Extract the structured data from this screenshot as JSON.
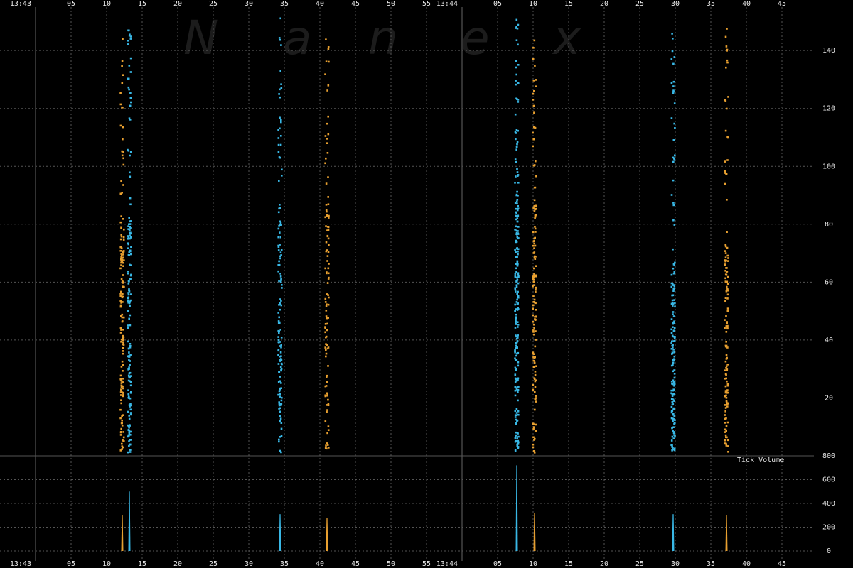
{
  "watermark": [
    "N",
    "a",
    "n",
    "e",
    "x"
  ],
  "chart_data": [
    {
      "type": "scatter",
      "title": "",
      "xlabel": "",
      "ylabel": "",
      "x_unit": "seconds after 13:43:00",
      "x_tick_labels": [
        "13:43",
        "05",
        "10",
        "15",
        "20",
        "25",
        "30",
        "35",
        "40",
        "45",
        "50",
        "55",
        "13:44",
        "05",
        "10",
        "15",
        "20",
        "25",
        "30",
        "35",
        "40",
        "45"
      ],
      "x_tick_values": [
        0,
        5,
        10,
        15,
        20,
        25,
        30,
        35,
        40,
        45,
        50,
        55,
        60,
        65,
        70,
        75,
        80,
        85,
        90,
        95,
        100,
        105
      ],
      "xlim": [
        0,
        115
      ],
      "y_ticks": [
        20,
        40,
        60,
        80,
        100,
        120,
        140
      ],
      "ylim": [
        0,
        155
      ],
      "grid": true,
      "colors": {
        "background": "#000000",
        "orange": "#e8a030",
        "blue": "#39b8e6",
        "grid": "#555555",
        "session_line": "#666666"
      },
      "series": [
        {
          "color": "orange",
          "x": 12.2,
          "y_range": [
            1,
            147
          ],
          "dense_below": 76,
          "count": 150
        },
        {
          "color": "blue",
          "x": 13.2,
          "y_range": [
            1,
            148
          ],
          "dense_below": 82,
          "count": 170
        },
        {
          "color": "blue",
          "x": 34.4,
          "y_range": [
            1,
            152
          ],
          "dense_below": 88,
          "count": 140
        },
        {
          "color": "orange",
          "x": 41.0,
          "y_range": [
            1,
            147
          ],
          "dense_below": 88,
          "count": 110
        },
        {
          "color": "blue",
          "x": 67.7,
          "y_range": [
            1,
            152
          ],
          "dense_below": 90,
          "count": 230
        },
        {
          "color": "orange",
          "x": 70.2,
          "y_range": [
            1,
            147
          ],
          "dense_below": 88,
          "count": 140
        },
        {
          "color": "blue",
          "x": 89.7,
          "y_range": [
            1,
            150
          ],
          "dense_below": 68,
          "count": 160
        },
        {
          "color": "orange",
          "x": 97.2,
          "y_range": [
            1,
            148
          ],
          "dense_below": 73,
          "count": 140
        }
      ]
    },
    {
      "type": "bar",
      "title": "Tick Volume",
      "y_ticks": [
        0,
        200,
        400,
        600,
        800
      ],
      "ylim": [
        0,
        800
      ],
      "bars": [
        {
          "color": "orange",
          "x": 12.2,
          "value": 300
        },
        {
          "color": "blue",
          "x": 13.2,
          "value": 500
        },
        {
          "color": "blue",
          "x": 34.4,
          "value": 310
        },
        {
          "color": "orange",
          "x": 41.0,
          "value": 280
        },
        {
          "color": "blue",
          "x": 67.7,
          "value": 720
        },
        {
          "color": "orange",
          "x": 70.2,
          "value": 320
        },
        {
          "color": "blue",
          "x": 89.7,
          "value": 310
        },
        {
          "color": "orange",
          "x": 97.2,
          "value": 300
        }
      ]
    }
  ]
}
